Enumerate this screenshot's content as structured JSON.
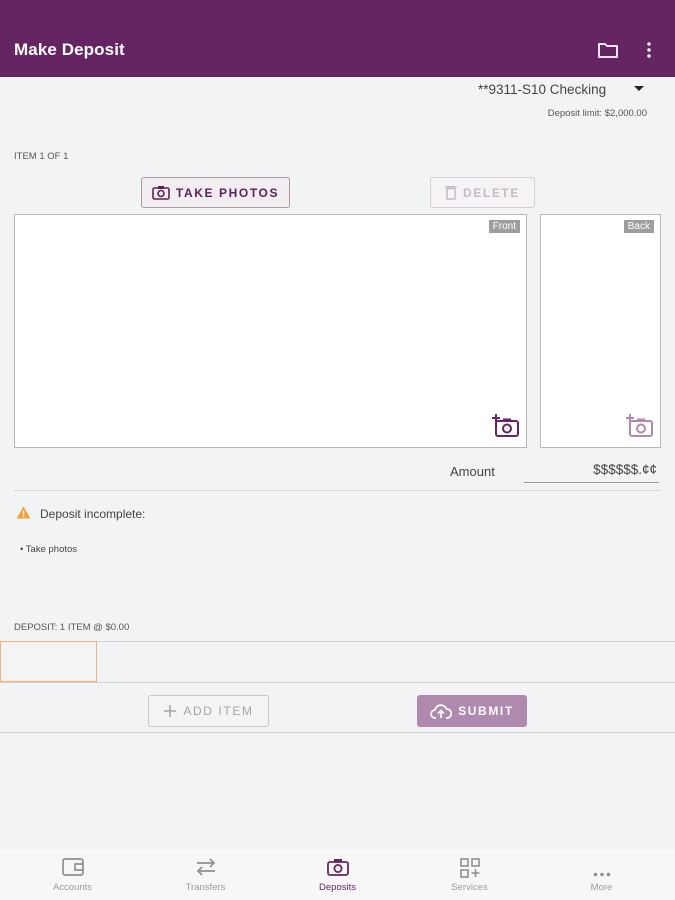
{
  "header": {
    "title": "Make Deposit",
    "folder_icon": "folder-icon",
    "menu_icon": "more-vertical-icon",
    "color": "#652563"
  },
  "account": {
    "selected": "**9311-S10 Checking",
    "limit": "Deposit limit: $2,000.00"
  },
  "item": {
    "label": "ITEM 1 OF 1",
    "take_photos": "TAKE PHOTOS",
    "delete": "DELETE"
  },
  "photos": {
    "front": "Front",
    "back": "Back"
  },
  "amount": {
    "label": "Amount",
    "placeholder": "$$$$$$.¢¢"
  },
  "status": {
    "warning": "Deposit incomplete:",
    "items": [
      "Take photos"
    ],
    "warning_color": "#f0a33a"
  },
  "summary": "DEPOSIT: 1 ITEM @ $0.00",
  "actions": {
    "add_item": "ADD ITEM",
    "submit": "SUBMIT"
  },
  "nav": [
    {
      "label": "Accounts",
      "icon": "wallet-icon"
    },
    {
      "label": "Transfers",
      "icon": "transfer-arrows-icon"
    },
    {
      "label": "Deposits",
      "icon": "camera-icon",
      "active": true
    },
    {
      "label": "Services",
      "icon": "grid-plus-icon"
    },
    {
      "label": "More",
      "icon": "more-horizontal-icon"
    }
  ]
}
